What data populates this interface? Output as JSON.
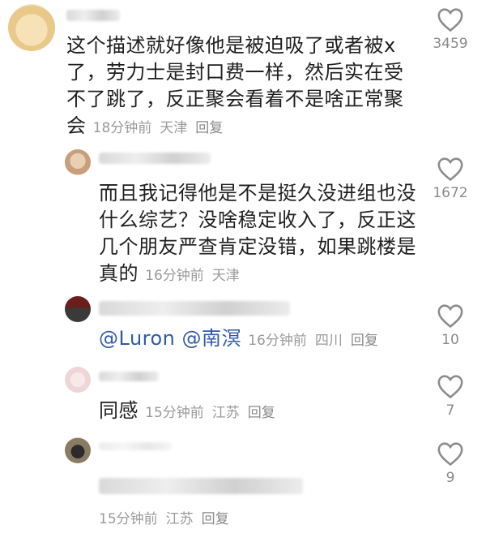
{
  "comments": [
    {
      "text_lines": [
        "这个描述就好像他是被迫吸了或者被x",
        "了，劳力士是封口费一样，然后实在受",
        "不了跳了，反正聚会看着不是啥正常聚",
        "会"
      ],
      "time": "18分钟前",
      "location": "天津",
      "reply": "回复",
      "likes": "3459"
    },
    {
      "text_lines": [
        "而且我记得他是不是挺久没进组也没",
        "什么综艺？没啥稳定收入了，反正这",
        "几个朋友严查肯定没错，如果跳楼是",
        "真的"
      ],
      "time": "16分钟前",
      "location": "天津",
      "likes": "1672"
    },
    {
      "mention1": "@Luron",
      "mention2": "@南溟",
      "time": "16分钟前",
      "location": "四川",
      "reply": "回复",
      "likes": "10"
    },
    {
      "text": "同感",
      "time": "15分钟前",
      "location": "江苏",
      "reply": "回复",
      "likes": "7"
    },
    {
      "time": "15分钟前",
      "location": "江苏",
      "reply": "回复",
      "likes": "9"
    }
  ],
  "colors": {
    "mention": "#2f5aa8",
    "meta": "#9a9a9a",
    "heart": "#8c8c8c"
  },
  "icons": {
    "like": "heart-icon"
  }
}
